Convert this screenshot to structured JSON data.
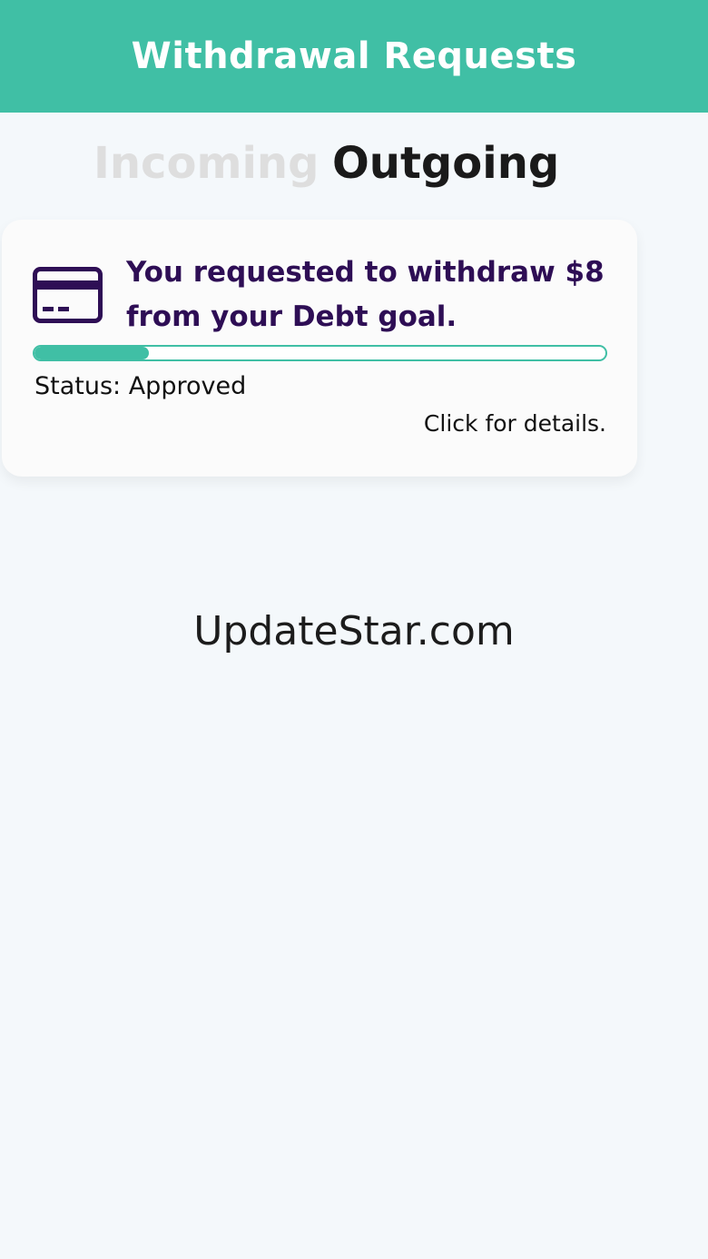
{
  "colors": {
    "header_bg": "#40bfa5",
    "accent_purple": "#2e0e55",
    "tab_inactive": "#dedede",
    "tab_active": "#1a1a1a",
    "progress": "#40bfa5"
  },
  "header": {
    "title": "Withdrawal Requests"
  },
  "tabs": [
    {
      "label": "Incoming",
      "active": false
    },
    {
      "label": "Outgoing",
      "active": true
    }
  ],
  "requests": [
    {
      "icon": "credit-card-icon",
      "message": "You requested to withdraw $8 from your Debt goal.",
      "progress": 0.2,
      "status": "Status: Approved",
      "details_label": "Click for details."
    }
  ],
  "watermark": "UpdateStar.com"
}
